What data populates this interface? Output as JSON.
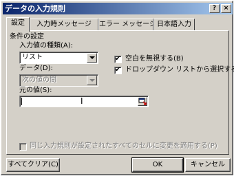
{
  "title": "データの入力規則",
  "help_label": "?",
  "close_label": "×",
  "tabs": [
    {
      "label": "設定"
    },
    {
      "label": "入力時メッセージ"
    },
    {
      "label": "エラー メッセージ"
    },
    {
      "label": "日本語入力"
    }
  ],
  "section_title": "条件の設定",
  "allow": {
    "label": "入力値の種類(A):",
    "value": "リスト"
  },
  "data": {
    "label": "データ(D):",
    "value": "次の値の間"
  },
  "source": {
    "label": "元の値(S):",
    "value": ""
  },
  "ignore_blank": {
    "label": "空白を無視する(B)",
    "checked": true
  },
  "in_cell_dropdown": {
    "label": "ドロップダウン リストから選択する(I)",
    "checked": true
  },
  "apply_all": {
    "label": "同じ入力規則が設定されたすべてのセルに変更を適用する(P)",
    "checked": false
  },
  "check_mark": "✔",
  "ibeam_glyph": "I",
  "buttons": {
    "clear_all": "すべてクリア(C)",
    "ok": "OK",
    "cancel": "キャンセル"
  },
  "colors": {
    "title_start": "#0a246a",
    "title_end": "#a6caf0",
    "face": "#d4d0c8"
  }
}
